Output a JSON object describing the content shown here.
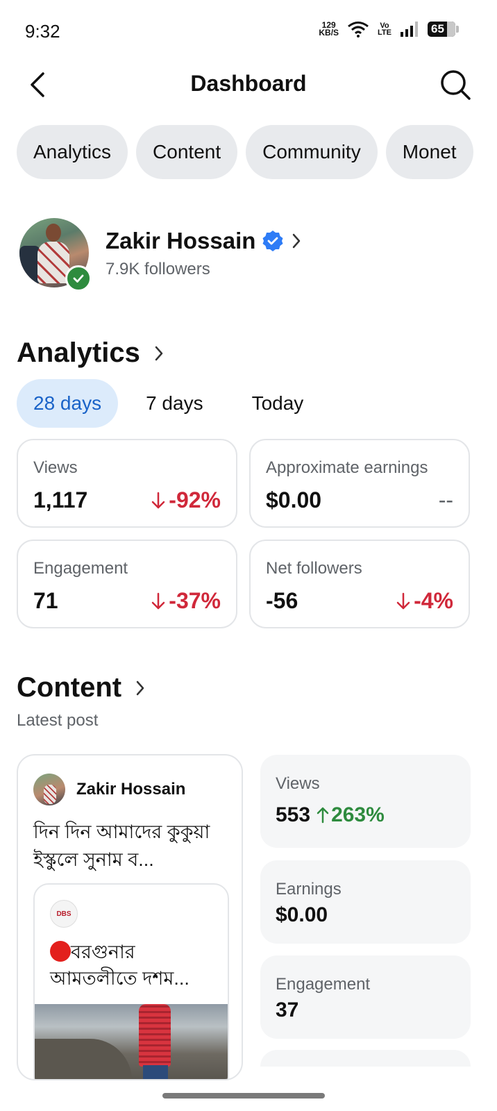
{
  "status_bar": {
    "time": "9:32",
    "net_speed_value": "129",
    "net_speed_unit": "KB/S",
    "volte_top": "Vo",
    "volte_bottom": "LTE",
    "battery": "65"
  },
  "header": {
    "title": "Dashboard",
    "back_icon": "chevron-left-icon",
    "search_icon": "search-icon"
  },
  "chips": [
    {
      "label": "Analytics"
    },
    {
      "label": "Content"
    },
    {
      "label": "Community"
    },
    {
      "label": "Monet"
    }
  ],
  "profile": {
    "name": "Zakir Hossain",
    "followers": "7.9K followers",
    "verified_color": "#2e7cf6"
  },
  "analytics": {
    "title": "Analytics",
    "periods": [
      {
        "label": "28 days",
        "active": true
      },
      {
        "label": "7 days",
        "active": false
      },
      {
        "label": "Today",
        "active": false
      }
    ],
    "metrics": [
      {
        "label": "Views",
        "value": "1,117",
        "change": "-92%"
      },
      {
        "label": "Approximate earnings",
        "value": "$0.00",
        "change": "--"
      },
      {
        "label": "Engagement",
        "value": "71",
        "change": "-37%"
      },
      {
        "label": "Net followers",
        "value": "-56",
        "change": "-4%"
      }
    ],
    "negative_color": "#d0283a",
    "positive_color": "#2e8b3e"
  },
  "content": {
    "title": "Content",
    "subtitle": "Latest post",
    "post": {
      "author": "Zakir Hossain",
      "text": "দিন দিন আমাদের কুকুয়া ইস্কুলে সুনাম ব...",
      "shared": {
        "logo_text": "DBS",
        "text": "বরগুনার আমতলীতে দশম..."
      }
    },
    "stats": [
      {
        "label": "Views",
        "value": "553",
        "change": "263%"
      },
      {
        "label": "Earnings",
        "value": "$0.00",
        "change": ""
      },
      {
        "label": "Engagement",
        "value": "37",
        "change": ""
      }
    ]
  }
}
